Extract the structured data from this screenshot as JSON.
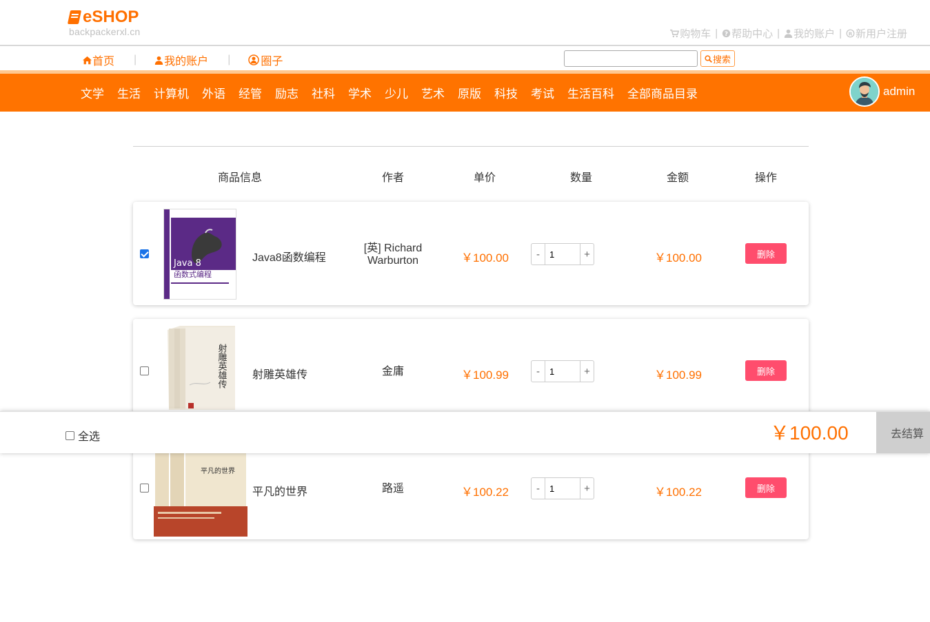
{
  "header": {
    "logo_text": "eSHOP",
    "logo_sub": "backpackerxl.cn",
    "top_links": [
      {
        "icon": "cart-icon",
        "label": "购物车"
      },
      {
        "icon": "question-circle-icon",
        "label": "帮助中心"
      },
      {
        "icon": "user-icon",
        "label": "我的账户"
      },
      {
        "icon": "registered-icon",
        "label": "新用户注册"
      }
    ],
    "separator": "|"
  },
  "subnav": {
    "links": [
      {
        "icon": "home-icon",
        "label": "首页"
      },
      {
        "icon": "user-icon",
        "label": "我的账户"
      },
      {
        "icon": "user-circle-icon",
        "label": "圈子"
      }
    ],
    "separator": "|"
  },
  "search": {
    "placeholder": "",
    "value": "",
    "button_label": "搜索"
  },
  "categories": [
    "文学",
    "生活",
    "计算机",
    "外语",
    "经管",
    "励志",
    "社科",
    "学术",
    "少儿",
    "艺术",
    "原版",
    "科技",
    "考试",
    "生活百科",
    "全部商品目录"
  ],
  "user": {
    "name": "admin"
  },
  "table_headers": {
    "info": "商品信息",
    "author": "作者",
    "price": "单价",
    "qty": "数量",
    "amount": "金额",
    "action": "操作"
  },
  "cart_items": [
    {
      "title": "Java8函数编程",
      "author": "[英] Richard Warburton",
      "price": "￥100.00",
      "qty": "1",
      "amount": "￥100.00",
      "checked": true,
      "delete_label": "删除",
      "cover_text": "Java 8 函数式编程"
    },
    {
      "title": "射雕英雄传",
      "author": "金庸",
      "price": "￥100.99",
      "qty": "1",
      "amount": "￥100.99",
      "checked": false,
      "delete_label": "删除",
      "cover_text": "射雕英雄传"
    },
    {
      "title": "平凡的世界",
      "author": "路遥",
      "price": "￥100.22",
      "qty": "1",
      "amount": "￥100.22",
      "checked": false,
      "delete_label": "删除",
      "cover_text": "平凡的世界"
    }
  ],
  "stepper": {
    "minus": "-",
    "plus": "+"
  },
  "footer": {
    "select_all_label": "全选",
    "total": "￥100.00",
    "checkout_label": "去结算"
  },
  "colors": {
    "accent": "#ff7300",
    "price": "#ff7000",
    "delete": "#ff4d6d",
    "checkout_bg": "#cfcfcf"
  }
}
